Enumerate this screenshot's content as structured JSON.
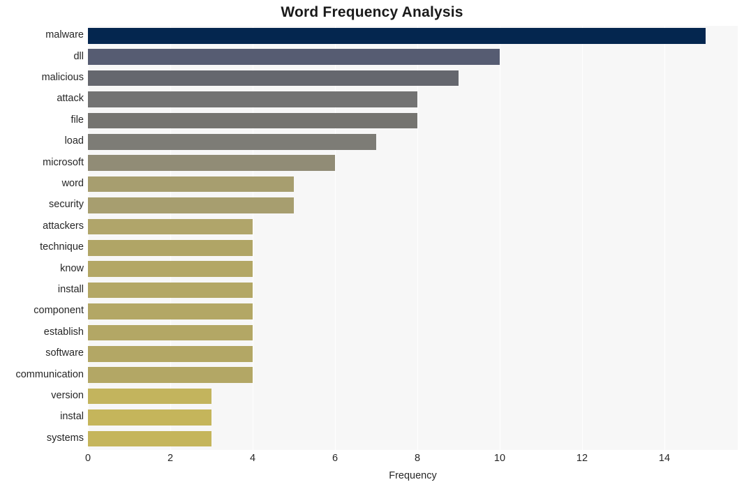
{
  "chart_data": {
    "type": "bar",
    "orientation": "horizontal",
    "title": "Word Frequency Analysis",
    "xlabel": "Frequency",
    "ylabel": "",
    "categories": [
      "malware",
      "dll",
      "malicious",
      "attack",
      "file",
      "load",
      "microsoft",
      "word",
      "security",
      "attackers",
      "technique",
      "know",
      "install",
      "component",
      "establish",
      "software",
      "communication",
      "version",
      "instal",
      "systems"
    ],
    "values": [
      15,
      10,
      9,
      8,
      8,
      7,
      6,
      5,
      5,
      4,
      4,
      4,
      4,
      4,
      4,
      4,
      4,
      3,
      3,
      3
    ],
    "bar_colors": [
      "#04264f",
      "#565c72",
      "#65676e",
      "#737373",
      "#757470",
      "#7d7c76",
      "#918c76",
      "#a79e6f",
      "#a79e6f",
      "#b0a56a",
      "#b0a566",
      "#b3a765",
      "#b3a765",
      "#b3a765",
      "#b3a765",
      "#b3a765",
      "#b3a765",
      "#c3b45d",
      "#c5b55b",
      "#c5b55b"
    ],
    "xticks": [
      0,
      2,
      4,
      6,
      8,
      10,
      12,
      14
    ],
    "xtick_labels": [
      "0",
      "2",
      "4",
      "6",
      "8",
      "10",
      "12",
      "14"
    ],
    "xlim": [
      0,
      15.78
    ],
    "grid": {
      "vertical": true,
      "horizontal": true,
      "color": "#ffffff"
    },
    "plot_background": "#f7f7f7",
    "figure_background": "#ffffff",
    "legend": null,
    "annotations": []
  }
}
